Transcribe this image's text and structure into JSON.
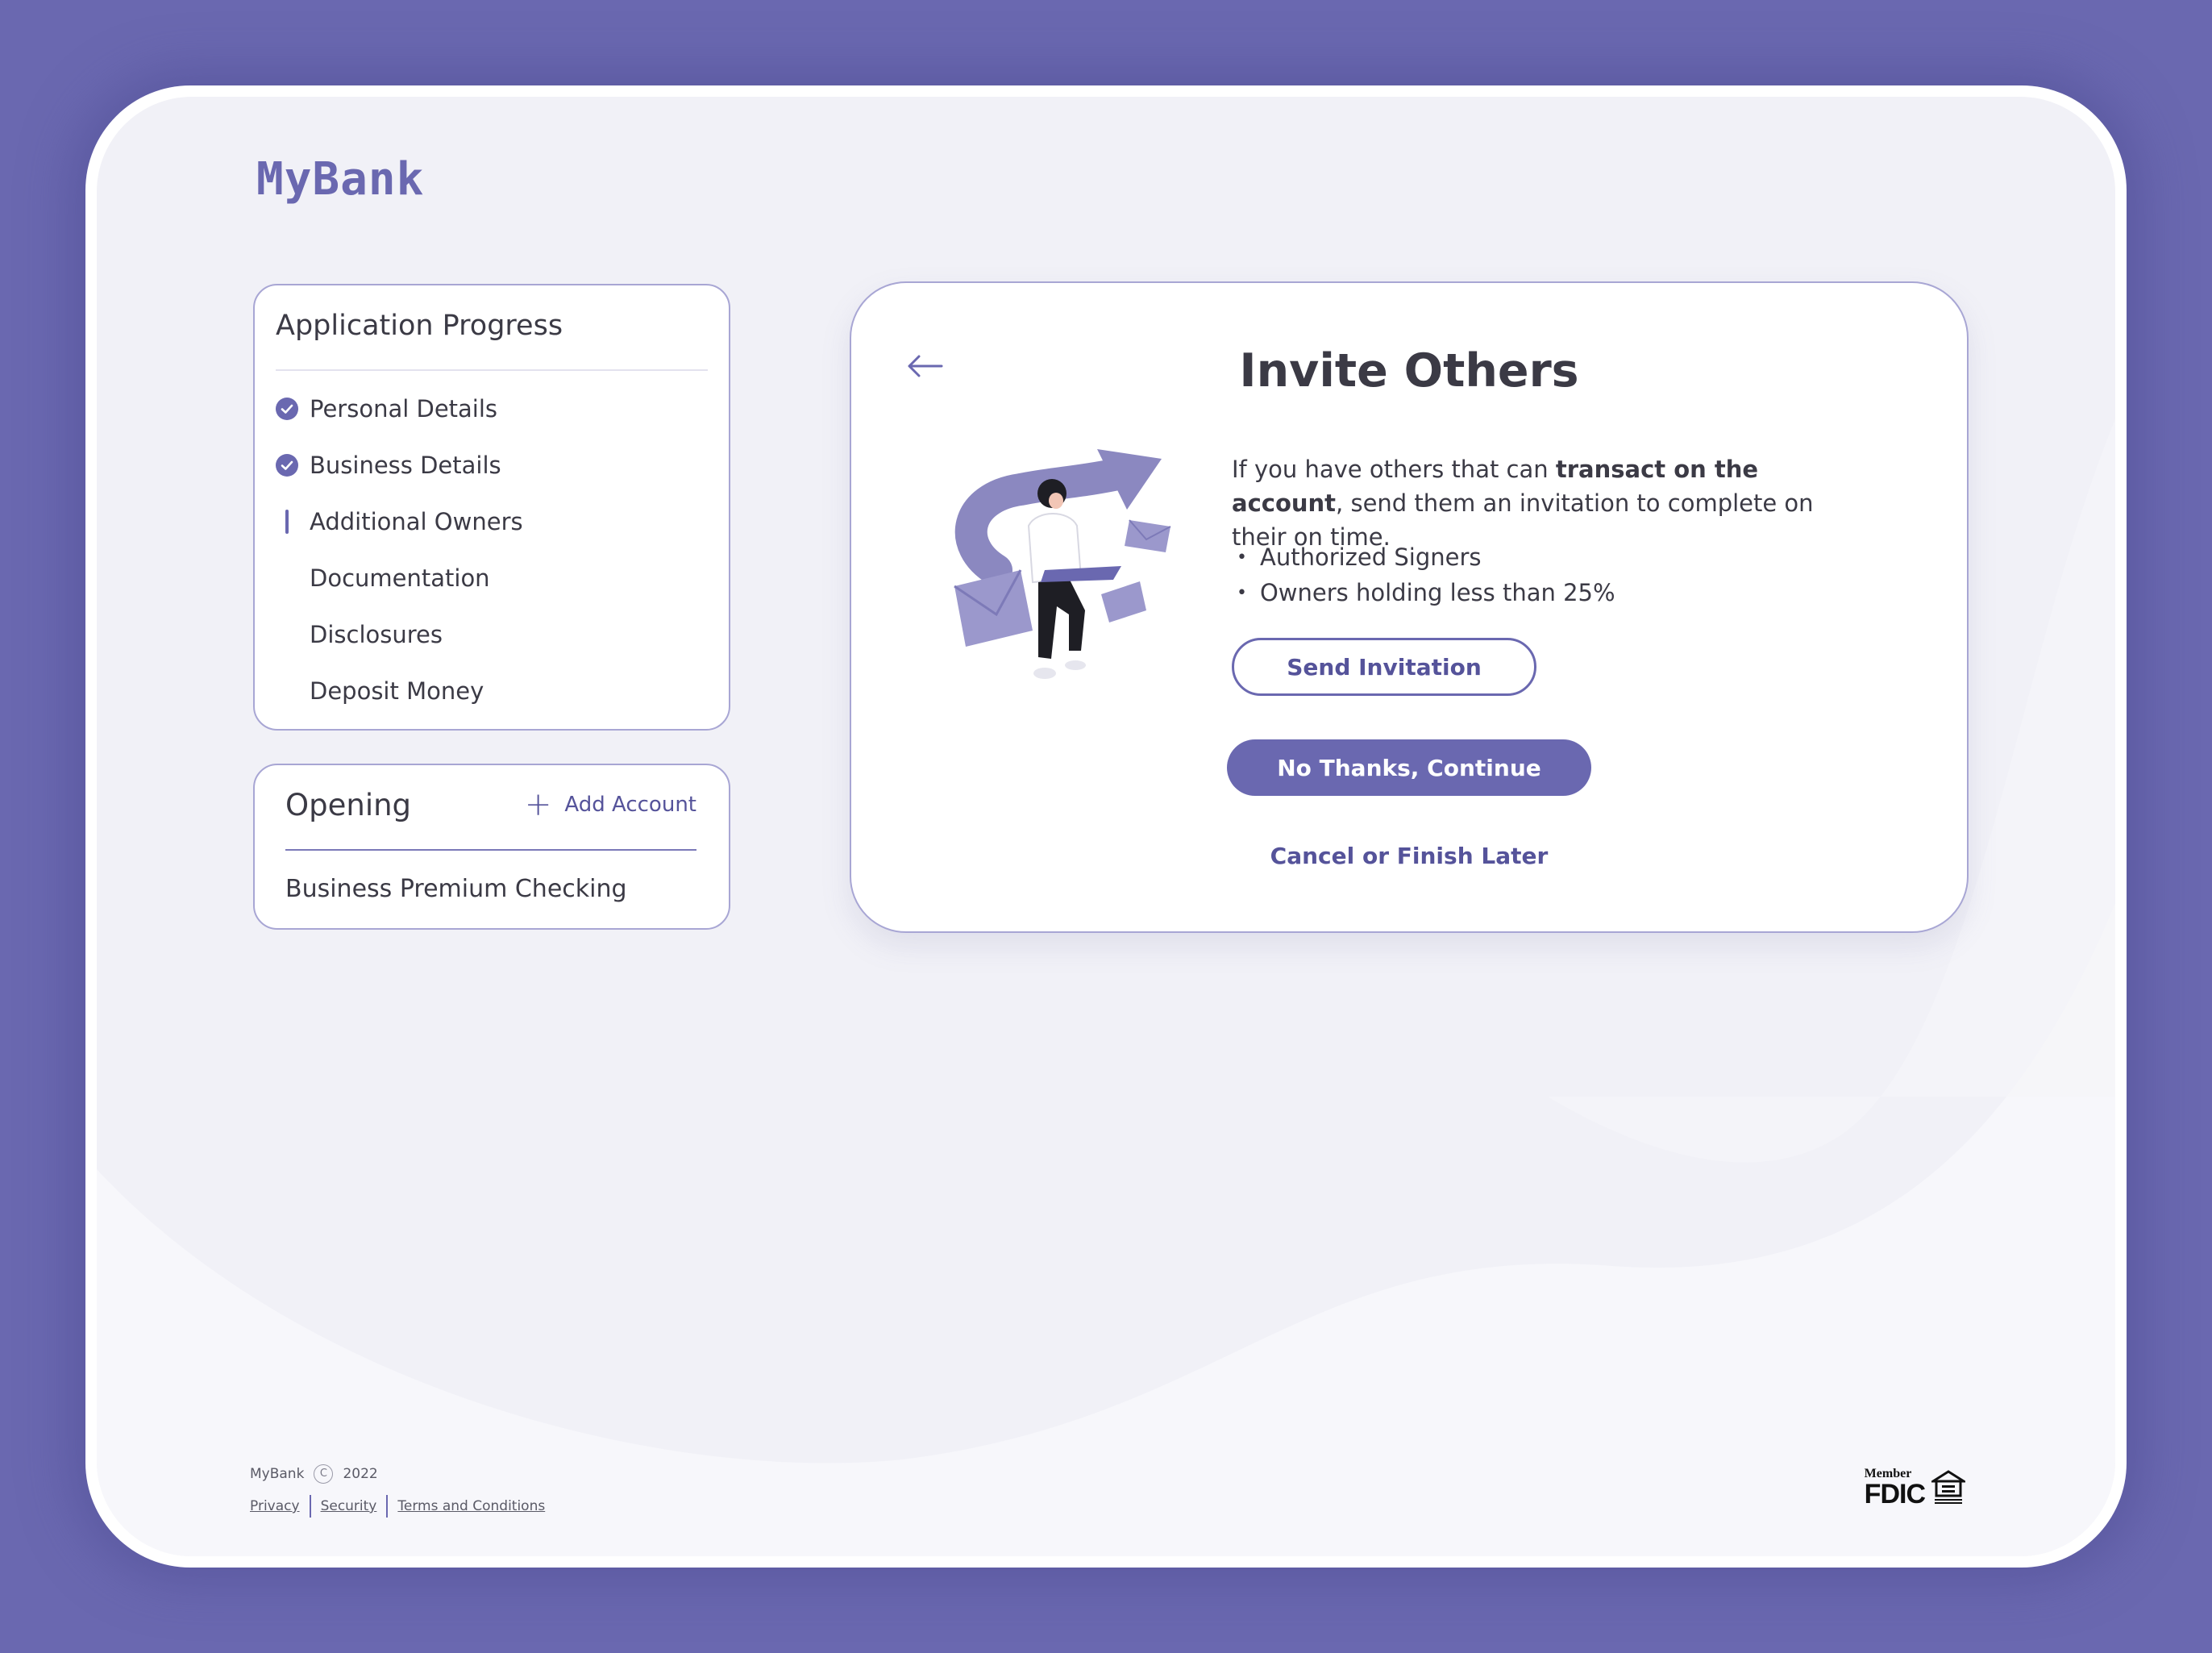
{
  "brand": {
    "logo": "MyBank",
    "accent": "#6a68b0"
  },
  "progress": {
    "title": "Application Progress",
    "steps": [
      {
        "label": "Personal Details",
        "status": "complete"
      },
      {
        "label": "Business Details",
        "status": "complete"
      },
      {
        "label": "Additional Owners",
        "status": "current"
      },
      {
        "label": "Documentation",
        "status": "pending"
      },
      {
        "label": "Disclosures",
        "status": "pending"
      },
      {
        "label": "Deposit Money",
        "status": "pending"
      }
    ]
  },
  "opening": {
    "title": "Opening",
    "add_label": "Add Account",
    "account": "Business Premium Checking"
  },
  "invite": {
    "back_icon": "arrow-left-icon",
    "title": "Invite Others",
    "desc_prefix": "If you have others that can ",
    "desc_bold": "transact on the account",
    "desc_suffix": ", send them an invitation to complete on their on time.",
    "bullets": [
      "Authorized Signers",
      "Owners holding less than 25%"
    ],
    "send_label": "Send Invitation",
    "continue_label": "No Thanks, Continue",
    "cancel_label": "Cancel or Finish Later"
  },
  "footer": {
    "brand": "MyBank",
    "copyright_symbol": "C",
    "year": "2022",
    "links": [
      "Privacy",
      "Security",
      "Terms and Conditions"
    ],
    "fdic_member": "Member",
    "fdic_name": "FDIC"
  }
}
